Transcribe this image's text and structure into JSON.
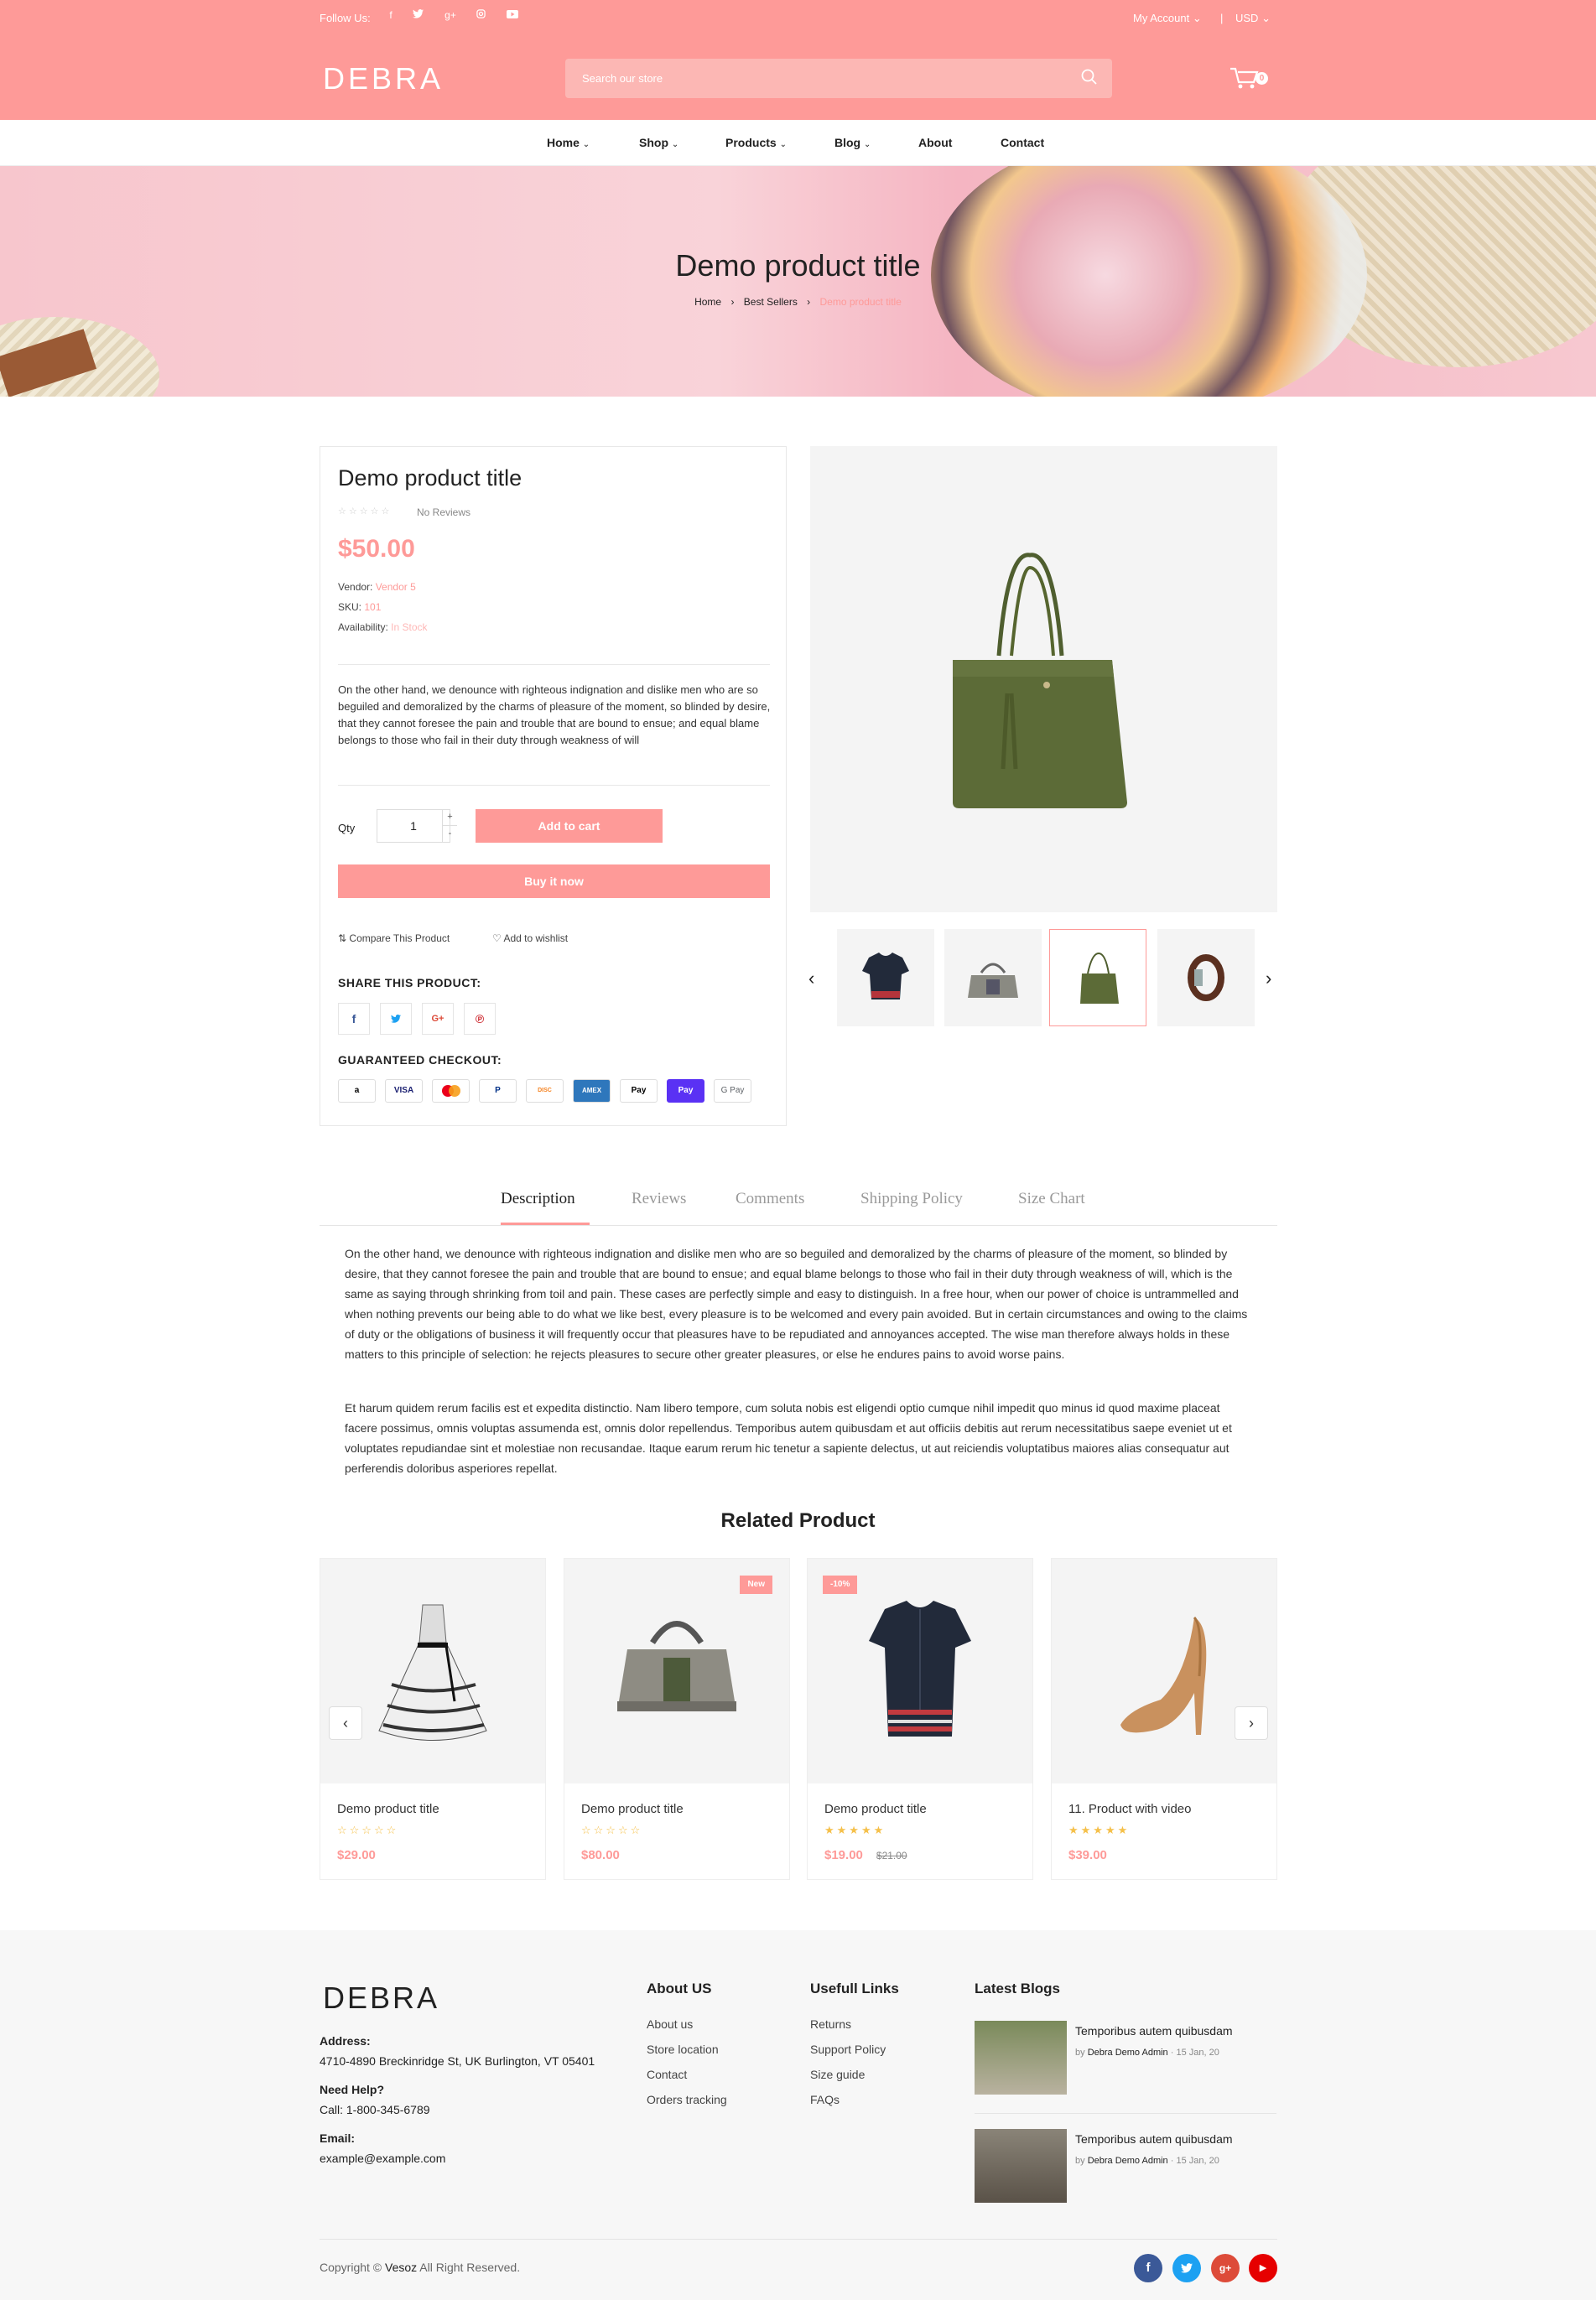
{
  "header": {
    "follow_label": "Follow Us:",
    "social": [
      "f",
      "t",
      "g+",
      "ig",
      "yt"
    ],
    "account": "My Account",
    "currency": "USD",
    "logo": "DEBRA",
    "search_placeholder": "Search our store",
    "cart_count": "0"
  },
  "nav": [
    "Home",
    "Shop",
    "Products",
    "Blog",
    "About",
    "Contact"
  ],
  "banner": {
    "title": "Demo product title",
    "crumbs": [
      "Home",
      "Best Sellers",
      "Demo product title"
    ]
  },
  "product": {
    "title": "Demo product title",
    "reviews": "No Reviews",
    "price": "$50.00",
    "vendor_label": "Vendor:",
    "vendor": "Vendor 5",
    "sku_label": "SKU:",
    "sku": "101",
    "availability_label": "Availability:",
    "availability": "In Stock",
    "description": "On the other hand, we denounce with righteous indignation and dislike men who are so beguiled and demoralized by the charms of pleasure of the moment, so blinded by desire, that they cannot foresee the pain and trouble that are bound to ensue; and equal blame belongs to those who fail in their duty through weakness of will",
    "qty_label": "Qty",
    "qty": "1",
    "add_to_cart": "Add to cart",
    "buy_now": "Buy it now",
    "compare": "Compare This Product",
    "wishlist": "Add to wishlist",
    "share_heading": "SHARE THIS PRODUCT:",
    "checkout_heading": "GUARANTEED CHECKOUT:",
    "payments": [
      "a",
      "VISA",
      "MC",
      "P",
      "DISC",
      "AMEX",
      "Pay",
      "Pay",
      "G Pay"
    ]
  },
  "tabs": {
    "items": [
      "Description",
      "Reviews",
      "Comments",
      "Shipping Policy",
      "Size Chart"
    ],
    "para1": "On the other hand, we denounce with righteous indignation and dislike men who are so beguiled and demoralized by the charms of pleasure of the moment, so blinded by desire, that they cannot foresee the pain and trouble that are bound to ensue; and equal blame belongs to those who fail in their duty through weakness of will, which is the same as saying through shrinking from toil and pain. These cases are perfectly simple and easy to distinguish. In a free hour, when our power of choice is untrammelled and when nothing prevents our being able to do what we like best, every pleasure is to be welcomed and every pain avoided. But in certain circumstances and owing to the claims of duty or the obligations of business it will frequently occur that pleasures have to be repudiated and annoyances accepted. The wise man therefore always holds in these matters to this principle of selection: he rejects pleasures to secure other greater pleasures, or else he endures pains to avoid worse pains.",
    "para2": "Et harum quidem rerum facilis est et expedita distinctio. Nam libero tempore, cum soluta nobis est eligendi optio cumque nihil impedit quo minus id quod maxime placeat facere possimus, omnis voluptas assumenda est, omnis dolor repellendus. Temporibus autem quibusdam et aut officiis debitis aut rerum necessitatibus saepe eveniet ut et voluptates repudiandae sint et molestiae non recusandae. Itaque earum rerum hic tenetur a sapiente delectus, ut aut reiciendis voluptatibus maiores alias consequatur aut perferendis doloribus asperiores repellat."
  },
  "related": {
    "heading": "Related Product",
    "items": [
      {
        "name": "Demo product title",
        "price": "$29.00",
        "old": "",
        "badge": "",
        "rating": 0
      },
      {
        "name": "Demo product title",
        "price": "$80.00",
        "old": "",
        "badge": "New",
        "rating": 0
      },
      {
        "name": "Demo product title",
        "price": "$19.00",
        "old": "$21.00",
        "badge": "-10%",
        "rating": 5
      },
      {
        "name": "11. Product with video",
        "price": "$39.00",
        "old": "",
        "badge": "",
        "rating": 5
      }
    ]
  },
  "footer": {
    "logo": "DEBRA",
    "address_label": "Address:",
    "address": "4710-4890 Breckinridge St, UK Burlington, VT 05401",
    "help_label": "Need Help?",
    "help": "Call: 1-800-345-6789",
    "email_label": "Email:",
    "email": "example@example.com",
    "about_heading": "About US",
    "about_links": [
      "About us",
      "Store location",
      "Contact",
      "Orders tracking"
    ],
    "useful_heading": "Usefull Links",
    "useful_links": [
      "Returns",
      "Support Policy",
      "Size guide",
      "FAQs"
    ],
    "blogs_heading": "Latest Blogs",
    "blogs": [
      {
        "title": "Temporibus autem quibusdam",
        "by": "by",
        "author": "Debra Demo Admin",
        "date": "15 Jan, 20"
      },
      {
        "title": "Temporibus autem quibusdam",
        "by": "by",
        "author": "Debra Demo Admin",
        "date": "15 Jan, 20"
      }
    ],
    "copyright_pre": "Copyright ©",
    "copyright_brand": "Vesoz",
    "copyright_post": "All Right Reserved.",
    "social": [
      "f",
      "t",
      "g+",
      "▶"
    ]
  },
  "colors": {
    "accent": "#fe9a98",
    "facebook": "#3b5998",
    "twitter": "#1da1f2",
    "google": "#dd4b39",
    "youtube": "#e60000"
  }
}
